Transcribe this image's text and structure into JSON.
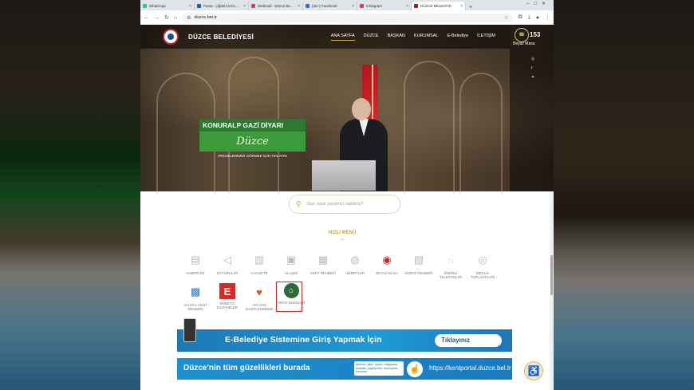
{
  "browser": {
    "tabs": [
      {
        "label": "WhatsApp",
        "color": "#25d366"
      },
      {
        "label": "Posta - çiğdem.kırm...",
        "color": "#0a66c2"
      },
      {
        "label": "Webmail - Düzce Be...",
        "color": "#e1306c"
      },
      {
        "label": "(25+) Facebook",
        "color": "#1877f2"
      },
      {
        "label": "Instagram",
        "color": "#e1306c"
      },
      {
        "label": "DÜZCE BELEDİYE",
        "color": "#b0141c"
      }
    ],
    "new_tab": "+",
    "url": "duzce.bel.tr"
  },
  "site": {
    "brand": "DÜZCE BELEDİYESİ",
    "menu": [
      "ANA SAYFA",
      "DÜZCE",
      "BAŞKAN",
      "KURUMSAL",
      "E-Belediye",
      "İLETİŞİM"
    ],
    "white_desk_number": "153",
    "white_desk_label": "Beyaz Masa",
    "promo": {
      "title": "KONURALP GAZİ DİYARI",
      "script": "Düzce",
      "caption": "PROJELERİMİZİ GÖRMEK İÇİN TIKLAYIN"
    },
    "search_placeholder": "Size nasıl yardımcı olabiliriz?",
    "quick_menu_title": "HIZLI MENÜ",
    "quick_items": [
      {
        "label": "HABERLER",
        "icon": "news-icon"
      },
      {
        "label": "DUYURULAR",
        "icon": "megaphone-icon"
      },
      {
        "label": "e-GAZETE",
        "icon": "newspaper-icon"
      },
      {
        "label": "ULAŞIM",
        "icon": "bus-icon"
      },
      {
        "label": "KENT REHBERİ",
        "icon": "city-icon"
      },
      {
        "label": "HİZMETLER",
        "icon": "services-icon"
      },
      {
        "label": "BEYAZ MASA",
        "icon": "white-desk-icon"
      },
      {
        "label": "DÜZCE REHBERİ",
        "icon": "chart-icon"
      },
      {
        "label": "ÖNEMLİ TELEFONLAR",
        "icon": "globe-icon"
      },
      {
        "label": "MECLİS TOPLANTILARI",
        "icon": "meeting-icon"
      },
      {
        "label": "ULUSAL KENT REHBERİ",
        "icon": "national-guide-icon"
      },
      {
        "label": "NÖBETÇİ ECZANELER",
        "icon": "pharmacy-icon"
      },
      {
        "label": "HAYVAN SAHİPLENDİRME",
        "icon": "pet-heart-icon"
      },
      {
        "label": "VEFAT EDENLER",
        "icon": "obituary-icon"
      }
    ],
    "banner1_text": "E-Belediye Sistemine Giriş Yapmak İçin",
    "banner1_button": "Tıklayınız",
    "banner2_text": "Düzce'nin tüm güzellikleri burada",
    "banner2_small": "şekerim, gitler, şeyler, mağazalar, sanatlar, paylaşımlar, tarihi yerler, kurumlar",
    "banner2_link": "https://kentportal.duzce.bel.tr"
  }
}
